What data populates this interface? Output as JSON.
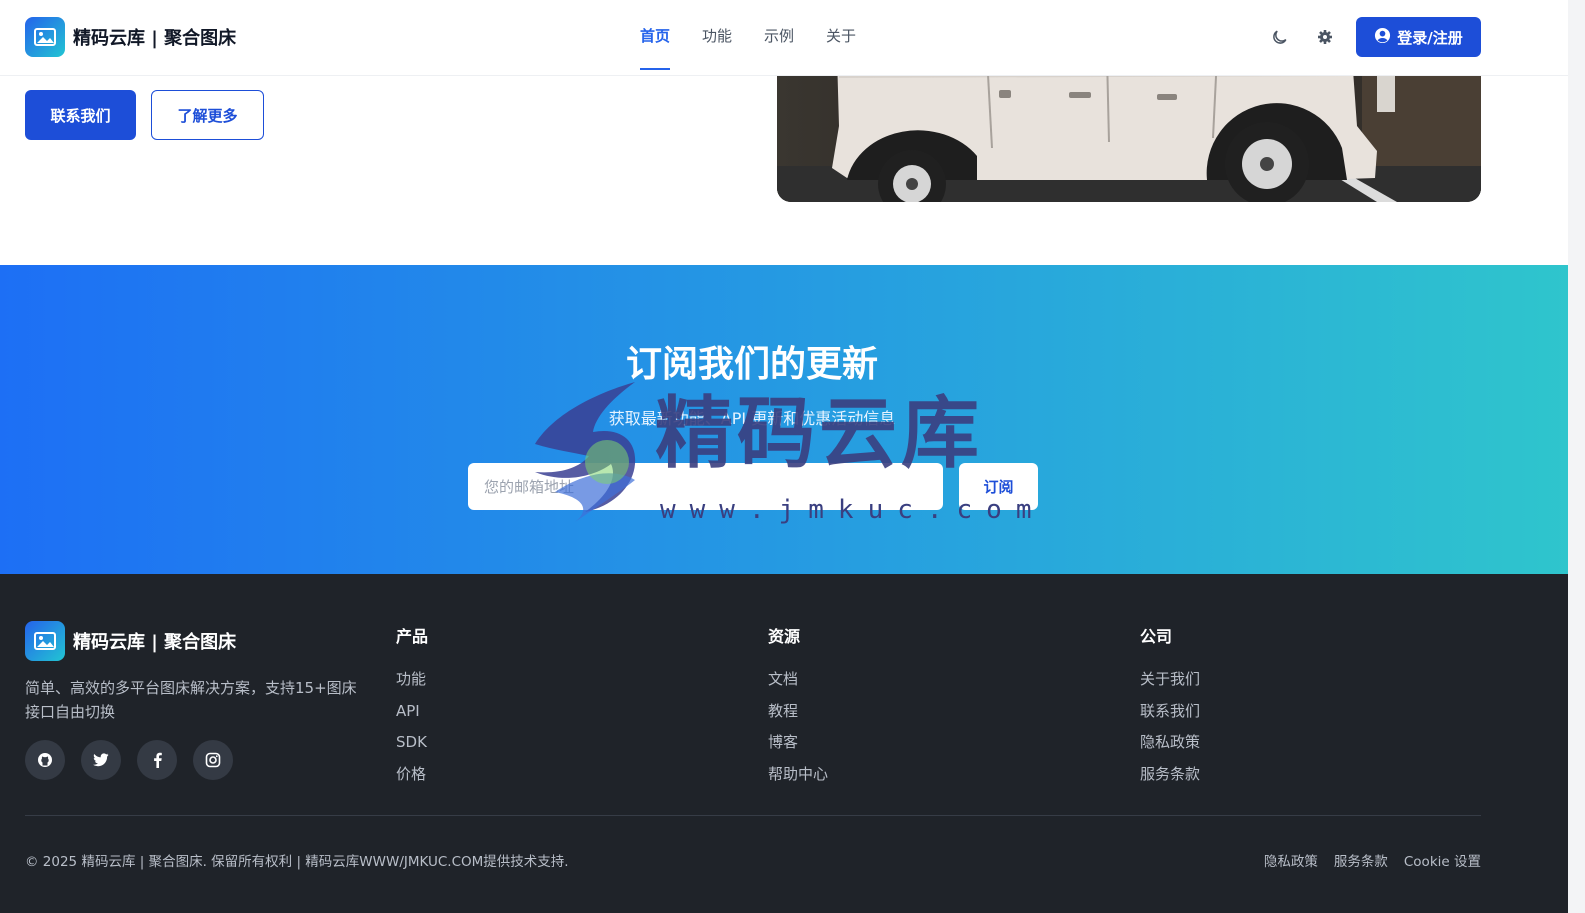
{
  "header": {
    "brand": "精码云库 | 聚合图床",
    "nav": [
      "首页",
      "功能",
      "示例",
      "关于"
    ],
    "active_nav": 0,
    "theme_icon": "moon-icon",
    "settings_icon": "gear-icon",
    "login_label": "登录/注册",
    "login_icon": "user-circle-icon"
  },
  "hero": {
    "contact_label": "联系我们",
    "learn_more_label": "了解更多"
  },
  "subscribe": {
    "title": "订阅我们的更新",
    "description": "获取最新功能、API 更新和优惠活动信息",
    "email_placeholder": "您的邮箱地址",
    "button_label": "订阅"
  },
  "watermark": {
    "title": "精码云库",
    "url": "www.jmkuc.com"
  },
  "footer": {
    "brand": "精码云库 | 聚合图床",
    "description": "简单、高效的多平台图床解决方案，支持15+图床接口自由切换",
    "socials": [
      "github-icon",
      "twitter-icon",
      "facebook-icon",
      "instagram-icon"
    ],
    "columns": [
      {
        "title": "产品",
        "links": [
          "功能",
          "API",
          "SDK",
          "价格"
        ]
      },
      {
        "title": "资源",
        "links": [
          "文档",
          "教程",
          "博客",
          "帮助中心"
        ]
      },
      {
        "title": "公司",
        "links": [
          "关于我们",
          "联系我们",
          "隐私政策",
          "服务条款"
        ]
      }
    ],
    "copyright": "© 2025 精码云库 | 聚合图床. 保留所有权利 | 精码云库WWW/JMKUC.COM提供技术支持.",
    "legal": [
      "隐私政策",
      "服务条款",
      "Cookie 设置"
    ]
  },
  "colors": {
    "accent": "#1d4ed8",
    "gradient_start": "#1d6ff5",
    "gradient_end": "#2fc6cc",
    "footer_bg": "#1f2329"
  }
}
